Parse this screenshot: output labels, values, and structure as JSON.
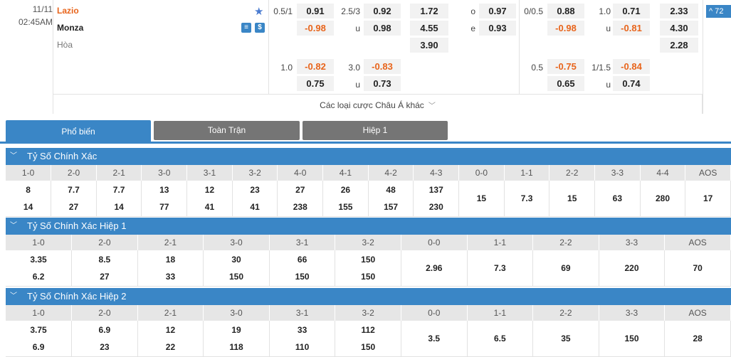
{
  "match": {
    "date": "11/11",
    "time": "02:45AM",
    "home": "Lazio",
    "away": "Monza",
    "draw": "Hòa",
    "badge_icons": [
      "list-icon",
      "dollar-icon"
    ],
    "more_label": "Các loại cược Châu Á khác",
    "count_label": "72",
    "ft": {
      "hdp_lines": [
        "0.5/1",
        "1.0"
      ],
      "hdp_home": [
        "0.91",
        "-0.82"
      ],
      "hdp_away": [
        "-0.98",
        "0.75"
      ],
      "ou_lines": [
        "2.5/3",
        "3.0"
      ],
      "ou_marks": [
        "u"
      ],
      "ou_over": [
        "0.92",
        "-0.83"
      ],
      "ou_under": [
        "0.98",
        "0.73"
      ],
      "x12": [
        "1.72",
        "4.55",
        "3.90"
      ],
      "oe_marks": [
        "o",
        "e"
      ],
      "oe": [
        "0.97",
        "0.93"
      ]
    },
    "h1": {
      "hdp_lines": [
        "0/0.5",
        "0.5"
      ],
      "hdp_home": [
        "0.88",
        "-0.75"
      ],
      "hdp_away": [
        "-0.98",
        "0.65"
      ],
      "ou_lines": [
        "1.0",
        "1/1.5"
      ],
      "ou_marks": [
        "u"
      ],
      "ou_over": [
        "0.71",
        "-0.84"
      ],
      "ou_under": [
        "-0.81",
        "0.74"
      ],
      "x12": [
        "2.33",
        "4.30",
        "2.28"
      ]
    }
  },
  "tabs": [
    "Phổ biến",
    "Toàn Trận",
    "Hiệp 1"
  ],
  "sections": [
    {
      "title": "Tỷ Số Chính Xác",
      "headers": [
        "1-0",
        "2-0",
        "2-1",
        "3-0",
        "3-1",
        "3-2",
        "4-0",
        "4-1",
        "4-2",
        "4-3",
        "0-0",
        "1-1",
        "2-2",
        "3-3",
        "4-4",
        "AOS"
      ],
      "home": [
        "8",
        "7.7",
        "7.7",
        "13",
        "12",
        "23",
        "27",
        "26",
        "48",
        "137"
      ],
      "away": [
        "14",
        "27",
        "14",
        "77",
        "41",
        "41",
        "238",
        "155",
        "157",
        "230"
      ],
      "single": [
        "15",
        "7.3",
        "15",
        "63",
        "280",
        "17"
      ]
    },
    {
      "title": "Tỷ Số Chính Xác Hiệp 1",
      "headers": [
        "1-0",
        "2-0",
        "2-1",
        "3-0",
        "3-1",
        "3-2",
        "0-0",
        "1-1",
        "2-2",
        "3-3",
        "AOS"
      ],
      "home": [
        "3.35",
        "8.5",
        "18",
        "30",
        "66",
        "150"
      ],
      "away": [
        "6.2",
        "27",
        "33",
        "150",
        "150",
        "150"
      ],
      "single": [
        "2.96",
        "7.3",
        "69",
        "220",
        "70"
      ]
    },
    {
      "title": "Tỷ Số Chính Xác Hiệp 2",
      "headers": [
        "1-0",
        "2-0",
        "2-1",
        "3-0",
        "3-1",
        "3-2",
        "0-0",
        "1-1",
        "2-2",
        "3-3",
        "AOS"
      ],
      "home": [
        "3.75",
        "6.9",
        "12",
        "19",
        "33",
        "112"
      ],
      "away": [
        "6.9",
        "23",
        "22",
        "118",
        "110",
        "150"
      ],
      "single": [
        "3.5",
        "6.5",
        "35",
        "150",
        "28"
      ]
    }
  ],
  "colors": {
    "accent": "#3a86c6",
    "negative": "#e8641b",
    "tab_inactive": "#757575"
  }
}
